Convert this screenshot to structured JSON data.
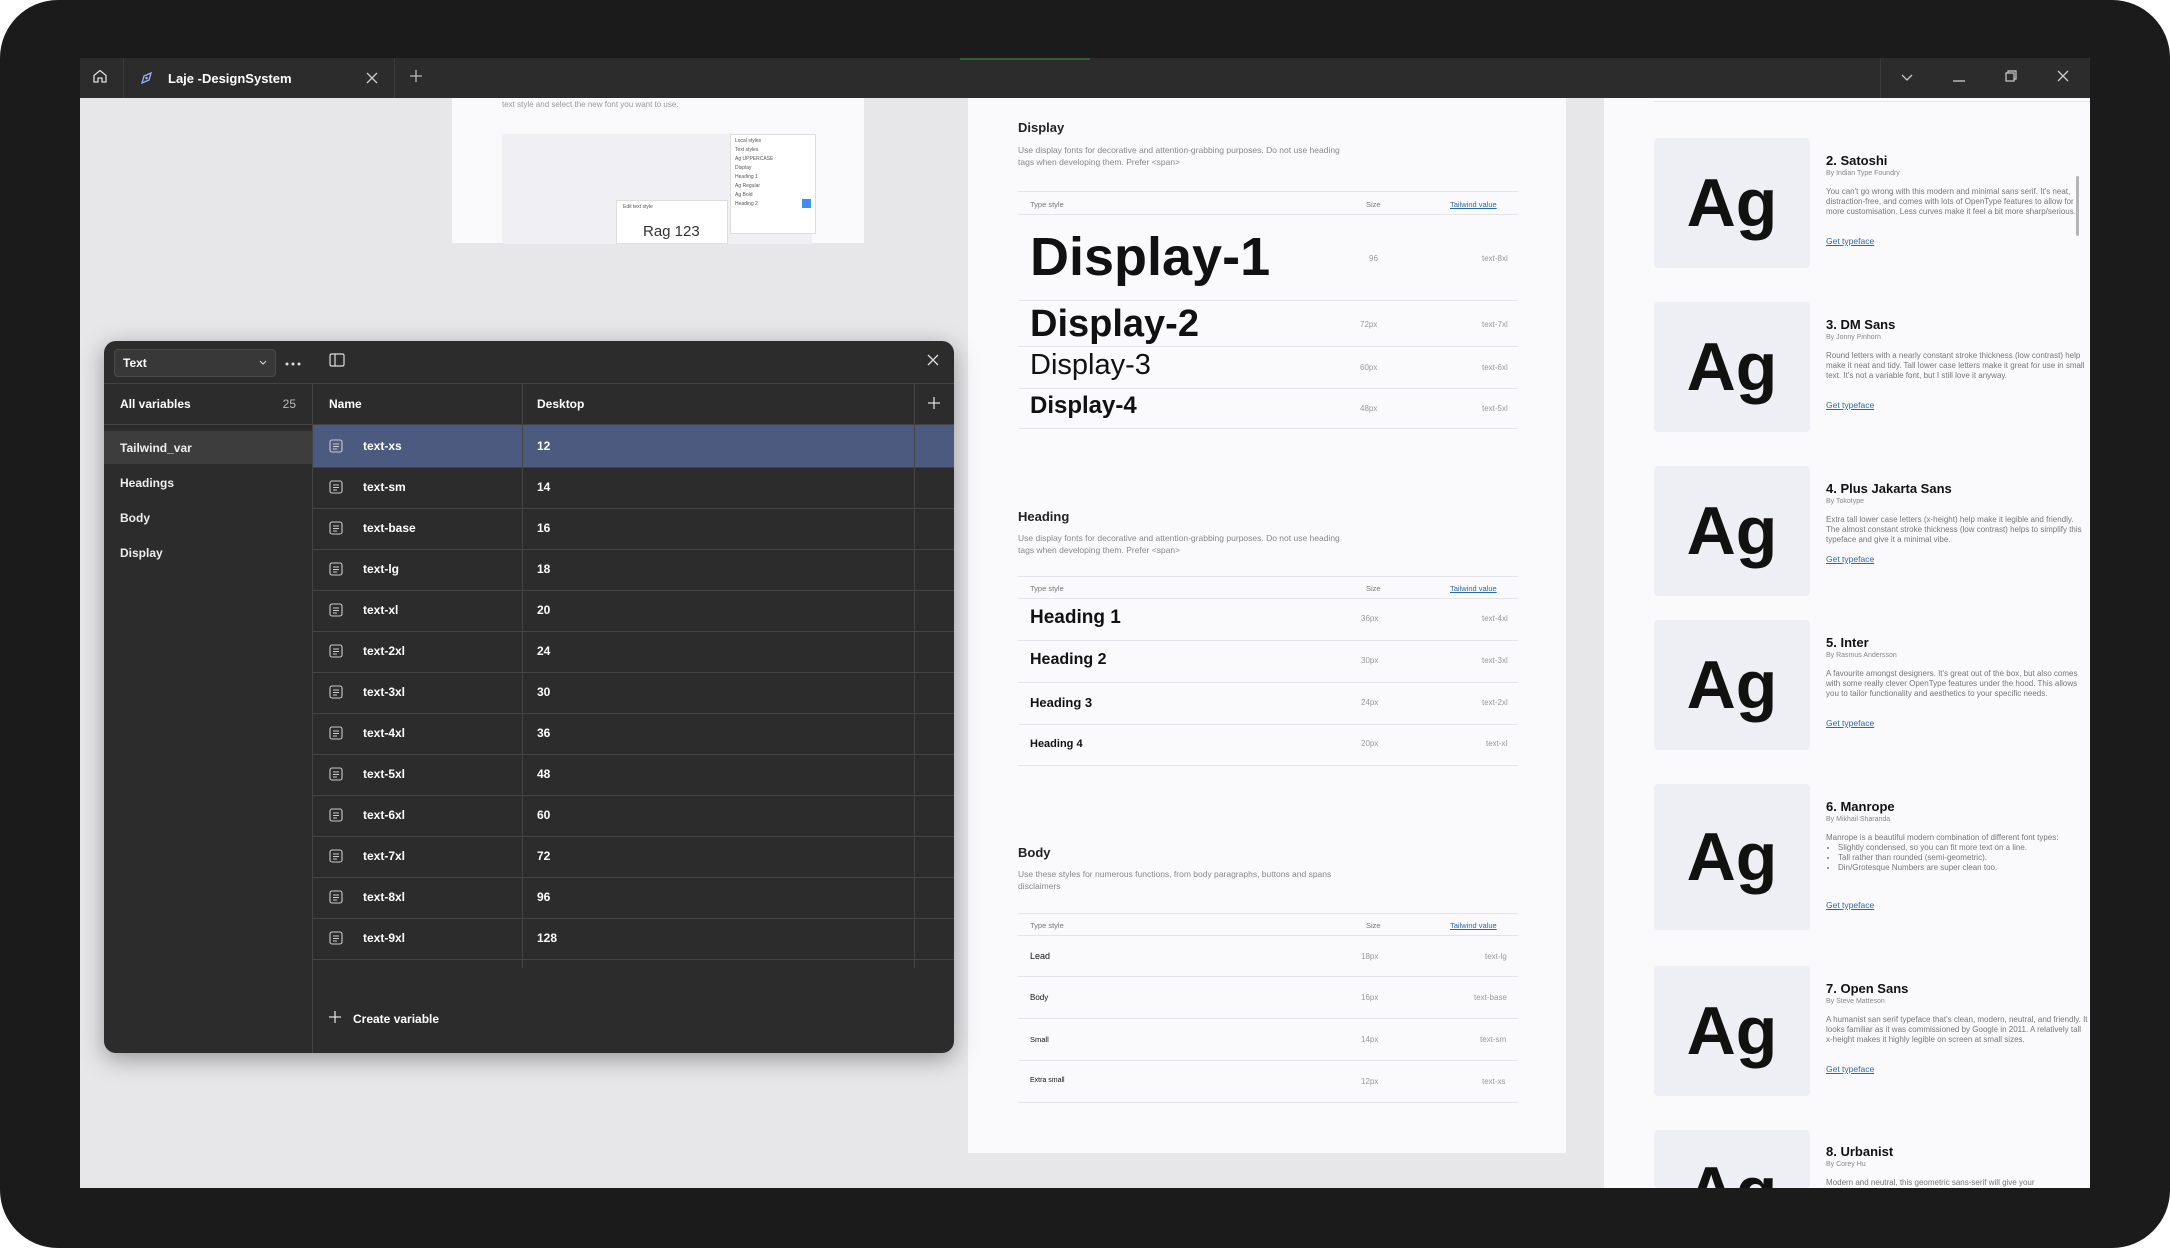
{
  "titlebar": {
    "tab_title": "Laje -DesignSystem"
  },
  "top_frame": {
    "hint": "text style and select the new font you want to use.",
    "mini_panel_title": "Local styles",
    "mini_panel_sub": "Text styles",
    "mini_row1": "Ag  UPPERCASE",
    "mini_row2": "Display",
    "mini_row3": "Heading 1",
    "mini_row4": "Ag  Regular",
    "mini_row5": "Ag  Bold",
    "mini_row6": "Heading 2",
    "mini_edit": "Edit text style",
    "sample": "Rag 123"
  },
  "display_section": {
    "title": "Display",
    "desc": "Use display fonts for decorative and attention-grabbing purposes. Do not use heading tags when developing them. Prefer <span>",
    "col_type": "Type style",
    "col_size": "Size",
    "col_tw": "Tailwind value",
    "rows": [
      {
        "name": "Display-1",
        "size": "96",
        "tw": "text-8xl"
      },
      {
        "name": "Display-2",
        "size": "72px",
        "tw": "text-7xl"
      },
      {
        "name": "Display-3",
        "size": "60px",
        "tw": "text-6xl"
      },
      {
        "name": "Display-4",
        "size": "48px",
        "tw": "text-5xl"
      }
    ]
  },
  "heading_section": {
    "title": "Heading",
    "desc": "Use display fonts for decorative and attention-grabbing purposes. Do not use heading tags when developing them. Prefer <span>",
    "col_type": "Type style",
    "col_size": "Size",
    "col_tw": "Tailwind value",
    "rows": [
      {
        "name": "Heading 1",
        "size": "36px",
        "tw": "text-4xl"
      },
      {
        "name": "Heading 2",
        "size": "30px",
        "tw": "text-3xl"
      },
      {
        "name": "Heading 3",
        "size": "24px",
        "tw": "text-2xl"
      },
      {
        "name": "Heading 4",
        "size": "20px",
        "tw": "text-xl"
      }
    ]
  },
  "body_section": {
    "title": "Body",
    "desc": "Use these styles for numerous functions, from body paragraphs, buttons and spans disclaimers",
    "col_type": "Type style",
    "col_size": "Size",
    "col_tw": "Tailwind value",
    "rows": [
      {
        "name": "Lead",
        "size": "18px",
        "tw": "text-lg"
      },
      {
        "name": "Body",
        "size": "16px",
        "tw": "text-base"
      },
      {
        "name": "Small",
        "size": "14px",
        "tw": "text-sm"
      },
      {
        "name": "Extra small",
        "size": "12px",
        "tw": "text-xs"
      }
    ]
  },
  "fonts": [
    {
      "sample": "Ag",
      "name": "2. Satoshi",
      "by": "By Indian Type Foundry",
      "desc": "You can't go wrong with this modern and minimal sans serif. It's neat, distraction-free, and comes with lots of OpenType features to allow for more customisation. Less curves make it feel a bit more sharp/serious.",
      "link": "Get typeface"
    },
    {
      "sample": "Ag",
      "name": "3. DM Sans",
      "by": "By Jonny Pinhorn",
      "desc": "Round letters with a nearly constant stroke thickness (low contrast) help make it neat and tidy. Tall lower case letters make it great for use in small text. It's not a variable font, but I still love it anyway.",
      "link": "Get typeface"
    },
    {
      "sample": "Ag",
      "name": "4. Plus Jakarta Sans",
      "by": "By Tokotype",
      "desc": "Extra tall lower case letters (x-height) help make it legible and friendly. The almost constant stroke thickness (low contrast) helps to simplify this typeface and give it a minimal vibe.",
      "link": "Get typeface"
    },
    {
      "sample": "Ag",
      "name": "5. Inter",
      "by": "By Rasmus Andersson",
      "desc": "A favourite amongst designers. It's great out of the box, but also comes with some really clever OpenType features under the hood. This allows you to tailor functionality and aesthetics to your specific needs.",
      "link": "Get typeface"
    },
    {
      "sample": "Ag",
      "name": "6. Manrope",
      "by": "By Mikhail Sharanda",
      "desc": "Manrope is a beautiful modern combination of different font types:",
      "bullets": [
        "Slightly condensed, so you can fit more text on a line.",
        "Tall rather than rounded (semi-geometric).",
        "Din/Grotesque Numbers are super clean too."
      ],
      "link": "Get typeface"
    },
    {
      "sample": "Ag",
      "name": "7. Open Sans",
      "by": "By Steve Matteson",
      "desc": "A humanist san serif typeface that's clean, modern, neutral, and friendly. It looks familiar as it was commissioned by Google in 2011. A relatively tall x-height makes it highly legible on screen at small sizes.",
      "link": "Get typeface"
    },
    {
      "sample": "Ag",
      "name": "8. Urbanist",
      "by": "By Corey Hu",
      "desc": "Modern and neutral, this geometric sans-serif will give your",
      "link": ""
    }
  ],
  "variables_panel": {
    "collection": "Text",
    "all_variables_label": "All variables",
    "all_variables_count": "25",
    "groups": [
      "Tailwind_var",
      "Headings",
      "Body",
      "Display"
    ],
    "col_name": "Name",
    "col_mode": "Desktop",
    "variables": [
      {
        "name": "text-xs",
        "value": "12"
      },
      {
        "name": "text-sm",
        "value": "14"
      },
      {
        "name": "text-base",
        "value": "16"
      },
      {
        "name": "text-lg",
        "value": "18"
      },
      {
        "name": "text-xl",
        "value": "20"
      },
      {
        "name": "text-2xl",
        "value": "24"
      },
      {
        "name": "text-3xl",
        "value": "30"
      },
      {
        "name": "text-4xl",
        "value": "36"
      },
      {
        "name": "text-5xl",
        "value": "48"
      },
      {
        "name": "text-6xl",
        "value": "60"
      },
      {
        "name": "text-7xl",
        "value": "72"
      },
      {
        "name": "text-8xl",
        "value": "96"
      },
      {
        "name": "text-9xl",
        "value": "128"
      }
    ],
    "create_label": "Create variable"
  }
}
